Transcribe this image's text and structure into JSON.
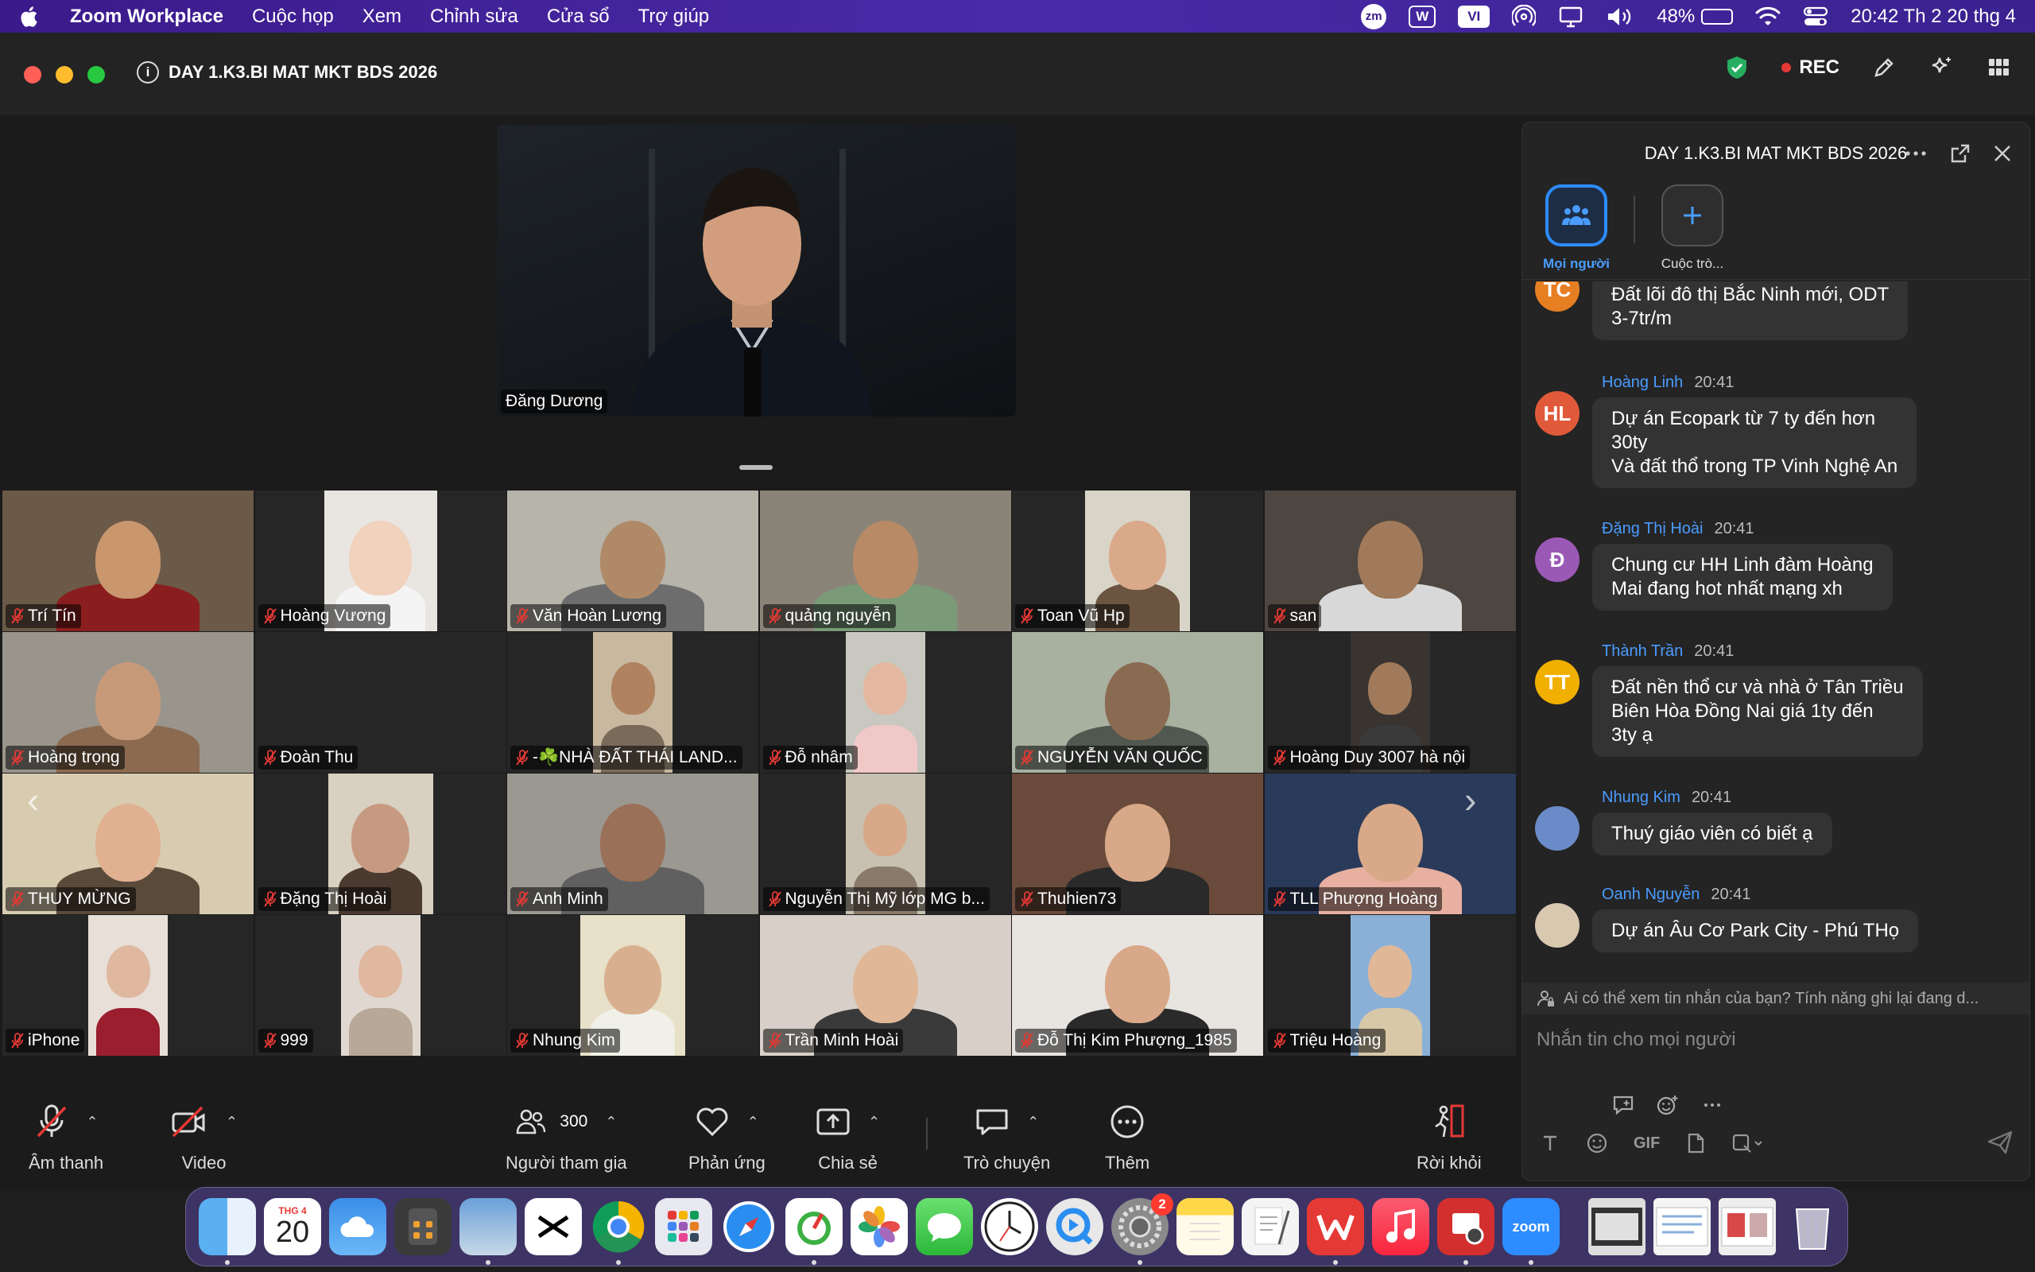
{
  "menubar": {
    "app_name": "Zoom Workplace",
    "menus": [
      "Cuộc họp",
      "Xem",
      "Chỉnh sửa",
      "Cửa sổ",
      "Trợ giúp"
    ],
    "status_zm": "zm",
    "status_w": "W",
    "status_vi": "VI",
    "battery_percent": "48%",
    "battery_level": 0.48,
    "clock": "20:42 Th 2 20 thg 4"
  },
  "window": {
    "title": "DAY 1.K3.BI MAT MKT BDS 2026",
    "rec_label": "REC",
    "colors": {
      "accent": "#2d8cff",
      "shield": "#27ae60",
      "rec": "#e53935"
    }
  },
  "speaker": {
    "name": "Đăng Dương"
  },
  "participants": [
    {
      "name": "Trí Tín",
      "bg": "#6b5a48",
      "skin": "#c9966e",
      "shirt": "#8a1e1e",
      "vw": 316
    },
    {
      "name": "Hoàng Vương",
      "bg": "#e9e6e2",
      "skin": "#f0d2bd",
      "shirt": "#f4f4f4",
      "vw": 142
    },
    {
      "name": "Văn Hoàn Lương",
      "bg": "#b7b4aa",
      "skin": "#b08a68",
      "shirt": "#6d6d6d",
      "vw": 316
    },
    {
      "name": "quảng nguyễn",
      "bg": "#8a8478",
      "skin": "#b98a66",
      "shirt": "#7a9a78",
      "vw": 316
    },
    {
      "name": "Toan Vũ Hp",
      "bg": "#d9d4c8",
      "skin": "#d9a98a",
      "shirt": "#6b5440",
      "vw": 132
    },
    {
      "name": "san",
      "bg": "#4e4640",
      "skin": "#a07a5a",
      "shirt": "#d8d8d8",
      "vw": 316
    },
    {
      "name": "Hoàng trọng",
      "bg": "#9a958c",
      "skin": "#c69a78",
      "shirt": "#8c6a50",
      "vw": 316
    },
    {
      "name": "Đoàn Thu",
      "bg": "#262626",
      "skin": "#262626",
      "shirt": "#262626",
      "vw": 0
    },
    {
      "name": "-☘️NHÀ ĐẤT THÁI LAND...",
      "bg": "#c8b8a0",
      "skin": "#b08260",
      "shirt": "#7a6a5a",
      "vw": 100
    },
    {
      "name": "Đỗ nhâm",
      "bg": "#c8c8c0",
      "skin": "#e4b8a0",
      "shirt": "#f0c8c8",
      "vw": 100
    },
    {
      "name": "NGUYỄN VĂN QUỐC",
      "bg": "#a8b0a0",
      "skin": "#8a6a50",
      "shirt": "#505850",
      "vw": 316
    },
    {
      "name": "Hoàng Duy 3007 hà nội",
      "bg": "#3a3430",
      "skin": "#a07a5a",
      "shirt": "#3a3a3a",
      "vw": 100
    },
    {
      "name": "THUY MỪNG",
      "bg": "#d8ccb0",
      "skin": "#e0b090",
      "shirt": "#5a4a3a",
      "vw": 316
    },
    {
      "name": "Đặng Thị Hoài",
      "bg": "#d8d0c0",
      "skin": "#c69a80",
      "shirt": "#4a3a30",
      "vw": 132
    },
    {
      "name": "Anh Minh",
      "bg": "#9a9890",
      "skin": "#9a7058",
      "shirt": "#606060",
      "vw": 316
    },
    {
      "name": "Nguyễn Thị Mỹ lớp MG b...",
      "bg": "#c8c0b0",
      "skin": "#d8a888",
      "shirt": "#8a7a6a",
      "vw": 100
    },
    {
      "name": "Thuhien73",
      "bg": "#6a4a3a",
      "skin": "#d8a888",
      "shirt": "#2a2a2a",
      "vw": 316
    },
    {
      "name": "TLL Phượng Hoàng",
      "bg": "#2a3a5a",
      "skin": "#d8a888",
      "shirt": "#e8b0a0",
      "vw": 316
    },
    {
      "name": "iPhone",
      "bg": "#e8e0d8",
      "skin": "#e0b8a0",
      "shirt": "#9a1e2e",
      "vw": 100
    },
    {
      "name": "999",
      "bg": "#e0d8d0",
      "skin": "#e0b8a0",
      "shirt": "#b8a898",
      "vw": 100
    },
    {
      "name": "Nhung Kim",
      "bg": "#e8e0c8",
      "skin": "#d8b090",
      "shirt": "#f0f0e8",
      "vw": 132
    },
    {
      "name": "Trần Minh Hoài",
      "bg": "#d8d0c8",
      "skin": "#e0b898",
      "shirt": "#3a3a3a",
      "vw": 316
    },
    {
      "name": "Đỗ Thị Kim Phượng_1985",
      "bg": "#e8e4e0",
      "skin": "#d8a888",
      "shirt": "#2a2a2a",
      "vw": 316
    },
    {
      "name": "Triệu Hoàng",
      "bg": "#8ab0d8",
      "skin": "#e0b898",
      "shirt": "#d8c8a8",
      "vw": 100
    }
  ],
  "toolbar": {
    "audio": "Âm thanh",
    "video": "Video",
    "participants": "Người tham gia",
    "participants_count": "300",
    "reactions": "Phản ứng",
    "share": "Chia sẻ",
    "chat": "Trò chuyện",
    "more": "Thêm",
    "leave": "Rời khỏi"
  },
  "chat": {
    "title": "DAY 1.K3.BI MAT MKT BDS 2026",
    "tab_everyone": "Mọi người",
    "tab_new": "Cuộc trò...",
    "messages": [
      {
        "initials": "TC",
        "avatar_color": "#e67e22",
        "sender": "",
        "time": "",
        "text": "Đất lõi đô thị Bắc Ninh mới, ODT\n3-7tr/m"
      },
      {
        "initials": "HL",
        "avatar_color": "#e05a3a",
        "sender": "Hoàng Linh",
        "time": "20:41",
        "text": "Dự án Ecopark từ 7 ty đến hơn\n30ty\nVà đất thổ trong TP Vinh Nghệ An"
      },
      {
        "initials": "Đ",
        "avatar_color": "#9b59b6",
        "sender": "Đặng Thị Hoài",
        "time": "20:41",
        "text": "Chung cư HH Linh đàm Hoàng\nMai đang hot nhất mạng xh"
      },
      {
        "initials": "TT",
        "avatar_color": "#f1b000",
        "sender": "Thành Trần",
        "time": "20:41",
        "text": "Đất nền thổ cư và nhà ở Tân Triều\nBiên Hòa Đồng Nai giá 1ty đến\n3ty ạ"
      },
      {
        "initials": "",
        "avatar_color": "#6a8ac8",
        "sender": "Nhung Kim",
        "time": "20:41",
        "text": "Thuý giáo viên có biết ạ"
      },
      {
        "initials": "",
        "avatar_color": "#d8c8b0",
        "sender": "Oanh Nguyễn",
        "time": "20:41",
        "text": "Dự án Âu Cơ Park City - Phú THọ"
      }
    ],
    "privacy_notice": "Ai có thể xem tin nhắn của bạn? Tính năng ghi lại đang d...",
    "compose_placeholder": "Nhắn tin cho mọi người",
    "gif_label": "GIF"
  },
  "dock": {
    "calendar_month": "THG 4",
    "calendar_day": "20",
    "settings_badge": "2",
    "zoom_label": "zoom"
  }
}
